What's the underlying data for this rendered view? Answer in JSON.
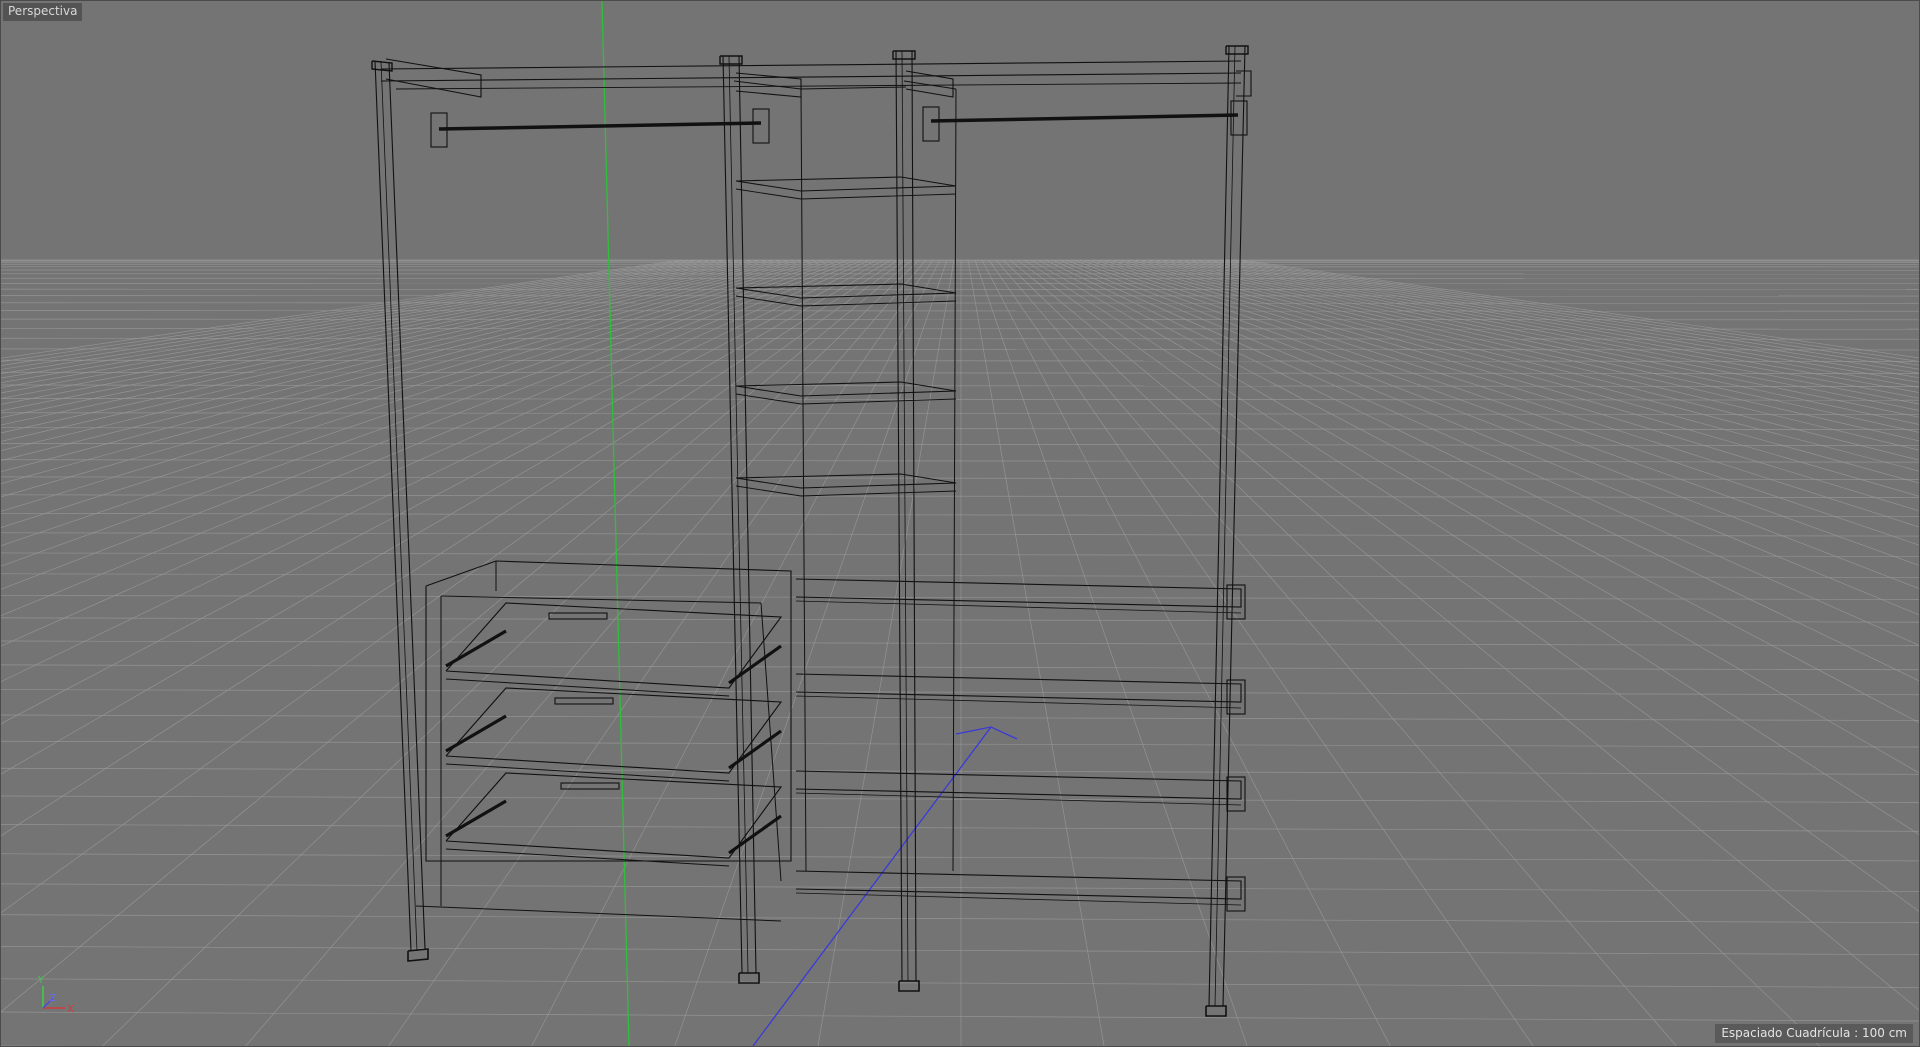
{
  "viewport": {
    "camera_label": "Perspectiva",
    "grid_spacing_text": "Espaciado Cuadrícula : 100 cm"
  },
  "axis_gizmo": {
    "y_label": "Y",
    "z_label": "Z",
    "x_label": "X"
  },
  "colors": {
    "background": "#747474",
    "sky": "#737373",
    "floor": "#6e6e6e",
    "grid_line": "#9b9b9b",
    "wireframe": "#111111",
    "green_axis": "#2fbf3a",
    "blue_axis": "#3a3ad8",
    "x_axis_red": "#d23b3b"
  }
}
